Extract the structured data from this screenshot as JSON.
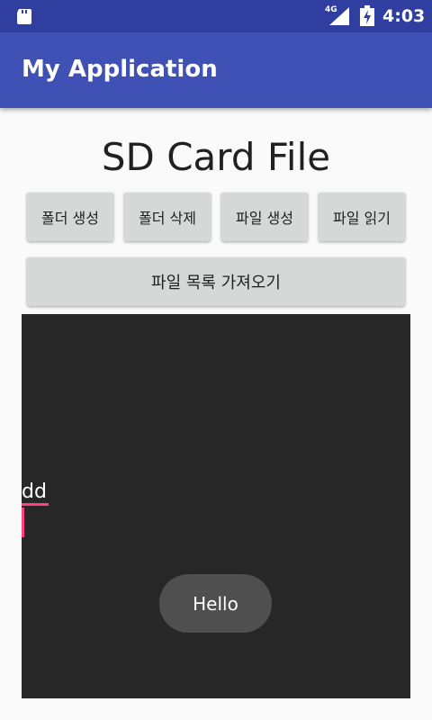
{
  "status_bar": {
    "network": "4G",
    "time": "4:03",
    "icons": [
      "sd-card-icon",
      "signal-icon",
      "battery-charging-icon"
    ]
  },
  "app_bar": {
    "title": "My Application"
  },
  "main": {
    "title": "SD Card File",
    "buttons": [
      {
        "label": "폴더 생성"
      },
      {
        "label": "폴더 삭제"
      },
      {
        "label": "파일 생성"
      },
      {
        "label": "파일 읽기"
      }
    ],
    "list_button_label": "파일 목록 가져오기"
  },
  "panel": {
    "input_value": "dd"
  },
  "toast": {
    "text": "Hello"
  },
  "colors": {
    "status_bar": "#303f9f",
    "app_bar": "#3f51b5",
    "accent": "#ff4081",
    "panel": "#272727",
    "button": "#d6d7d7",
    "toast": "#4f4f4f"
  }
}
